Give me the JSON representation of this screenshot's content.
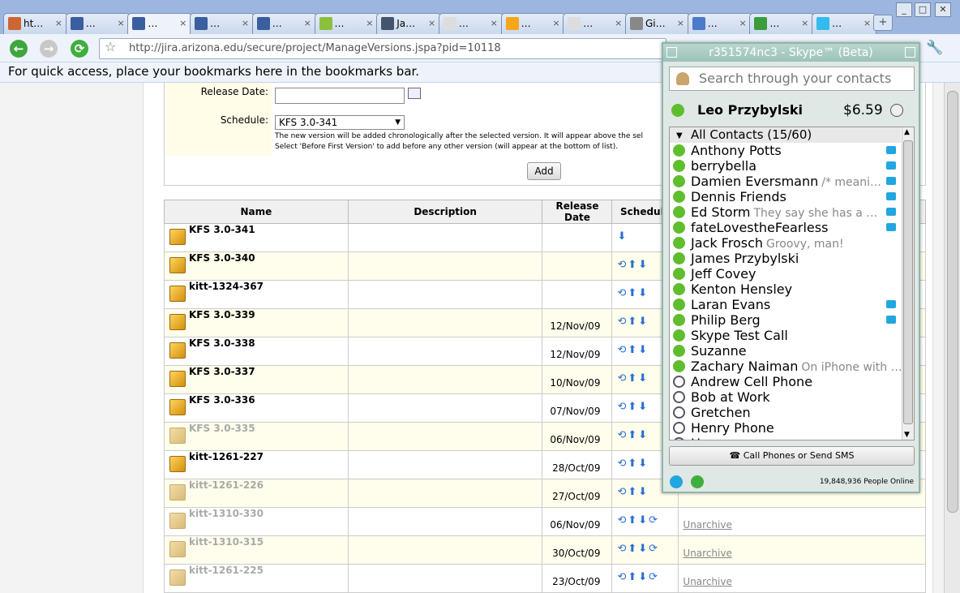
{
  "browser": {
    "tabs": [
      {
        "label": "ht…",
        "icon": "html-icon",
        "color": "#cc6633"
      },
      {
        "label": "…",
        "icon": "jira-icon",
        "color": "#3b5e9e"
      },
      {
        "label": "…",
        "icon": "jira-icon",
        "color": "#3b5e9e",
        "active": true
      },
      {
        "label": "…",
        "icon": "jira-icon",
        "color": "#3b5e9e"
      },
      {
        "label": "…",
        "icon": "jira-icon",
        "color": "#3b5e9e"
      },
      {
        "label": "…",
        "icon": "leaf-icon",
        "color": "#8cbf3c"
      },
      {
        "label": "Ja…",
        "icon": "sun-icon",
        "color": "#44566e"
      },
      {
        "label": "…",
        "icon": "page-icon",
        "color": "#dddddd"
      },
      {
        "label": "…",
        "icon": "amazon-icon",
        "color": "#f7a51a"
      },
      {
        "label": "…",
        "icon": "page-icon",
        "color": "#dddddd"
      },
      {
        "label": "Gi…",
        "icon": "google-icon",
        "color": "#888888"
      },
      {
        "label": "…",
        "icon": "document-icon",
        "color": "#4a7ac9"
      },
      {
        "label": "…",
        "icon": "google-icon",
        "color": "#3c9c3c"
      },
      {
        "label": "…",
        "icon": "twitter-icon",
        "color": "#33bbee"
      }
    ],
    "url": "http://jira.arizona.edu/secure/project/ManageVersions.jspa?pid=10118",
    "bookmarks_hint": "For quick access, place your bookmarks here in the bookmarks bar."
  },
  "form": {
    "release_date_label": "Release Date:",
    "release_date_value": "",
    "schedule_label": "Schedule:",
    "schedule_value": "KFS 3.0-341",
    "hint_line1": "The new version will be added chronologically after the selected version. It will appear above the sel",
    "hint_line2": "Select 'Before First Version' to add before any other version (will appear at the bottom of list).",
    "add_button": "Add"
  },
  "table": {
    "headers": {
      "name": "Name",
      "description": "Description",
      "release_date": "Release Date",
      "schedule": "Schedule"
    },
    "rows": [
      {
        "name": "KFS 3.0-341",
        "date": "",
        "archived": false,
        "schedule": "⬇",
        "ops": ""
      },
      {
        "name": "KFS 3.0-340",
        "date": "",
        "archived": false,
        "schedule": "⟲⬆⬇",
        "ops": ""
      },
      {
        "name": "kitt-1324-367",
        "date": "",
        "archived": false,
        "schedule": "⟲⬆⬇",
        "ops": ""
      },
      {
        "name": "KFS 3.0-339",
        "date": "12/Nov/09",
        "archived": false,
        "schedule": "⟲⬆⬇",
        "ops": ""
      },
      {
        "name": "KFS 3.0-338",
        "date": "12/Nov/09",
        "archived": false,
        "schedule": "⟲⬆⬇",
        "ops": ""
      },
      {
        "name": "KFS 3.0-337",
        "date": "10/Nov/09",
        "archived": false,
        "schedule": "⟲⬆⬇",
        "ops": ""
      },
      {
        "name": "KFS 3.0-336",
        "date": "07/Nov/09",
        "archived": false,
        "schedule": "⟲⬆⬇",
        "ops": ""
      },
      {
        "name": "KFS 3.0-335",
        "date": "06/Nov/09",
        "archived": true,
        "schedule": "⟲⬆⬇",
        "ops": ""
      },
      {
        "name": "kitt-1261-227",
        "date": "28/Oct/09",
        "archived": false,
        "schedule": "⟲⬆⬇",
        "ops": ""
      },
      {
        "name": "kitt-1261-226",
        "date": "27/Oct/09",
        "archived": true,
        "schedule": "⟲⬆⬇",
        "ops": ""
      },
      {
        "name": "kitt-1310-330",
        "date": "06/Nov/09",
        "archived": true,
        "schedule": "⟲⬆⬇⟳",
        "ops": "Unarchive"
      },
      {
        "name": "kitt-1310-315",
        "date": "30/Oct/09",
        "archived": true,
        "schedule": "⟲⬆⬇⟳",
        "ops": "Unarchive"
      },
      {
        "name": "kitt-1261-225",
        "date": "23/Oct/09",
        "archived": true,
        "schedule": "⟲⬆⬇⟳",
        "ops": "Unarchive"
      }
    ]
  },
  "skype": {
    "title": "r351574nc3 - Skype™ (Beta)",
    "search_placeholder": "Search through your contacts",
    "user_name": "Leo Przybylski",
    "credit": "$6.59",
    "group_label": "All Contacts (15/60)",
    "contacts": [
      {
        "name": "Anthony Potts",
        "mood": "",
        "online": true,
        "video": true
      },
      {
        "name": "berrybella",
        "mood": "",
        "online": true,
        "video": true
      },
      {
        "name": "Damien Eversmann",
        "mood": "/* meani…",
        "online": true,
        "video": true
      },
      {
        "name": "Dennis Friends",
        "mood": "",
        "online": true,
        "video": true
      },
      {
        "name": "Ed Storm",
        "mood": "They say she has a …",
        "online": true,
        "video": true
      },
      {
        "name": "fateLovestheFearless",
        "mood": "",
        "online": true,
        "video": true
      },
      {
        "name": "Jack Frosch",
        "mood": "Groovy, man!",
        "online": true,
        "video": false
      },
      {
        "name": "James Przybylski",
        "mood": "",
        "online": true,
        "video": false
      },
      {
        "name": "Jeff Covey",
        "mood": "",
        "online": true,
        "video": false
      },
      {
        "name": "Kenton Hensley",
        "mood": "",
        "online": true,
        "video": false
      },
      {
        "name": "Laran Evans",
        "mood": "",
        "online": true,
        "video": true
      },
      {
        "name": "Philip Berg",
        "mood": "",
        "online": true,
        "video": true
      },
      {
        "name": "Skype Test Call",
        "mood": "",
        "online": true,
        "video": false
      },
      {
        "name": "Suzanne",
        "mood": "",
        "online": true,
        "video": false
      },
      {
        "name": "Zachary Naiman",
        "mood": "On iPhone with …",
        "online": true,
        "video": false
      },
      {
        "name": "Andrew Cell Phone",
        "mood": "",
        "online": false,
        "video": false
      },
      {
        "name": "Bob at Work",
        "mood": "",
        "online": false,
        "video": false
      },
      {
        "name": "Gretchen",
        "mood": "",
        "online": false,
        "video": false
      },
      {
        "name": "Henry Phone",
        "mood": "",
        "online": false,
        "video": false
      },
      {
        "name": "Home",
        "mood": "",
        "online": false,
        "video": false
      }
    ],
    "call_button": "Call Phones or Send SMS",
    "people_online": "19,848,936 People Online"
  },
  "colors": {
    "online": "#5fbe2d",
    "video": "#22a6e0",
    "link": "#2a6ed3"
  }
}
